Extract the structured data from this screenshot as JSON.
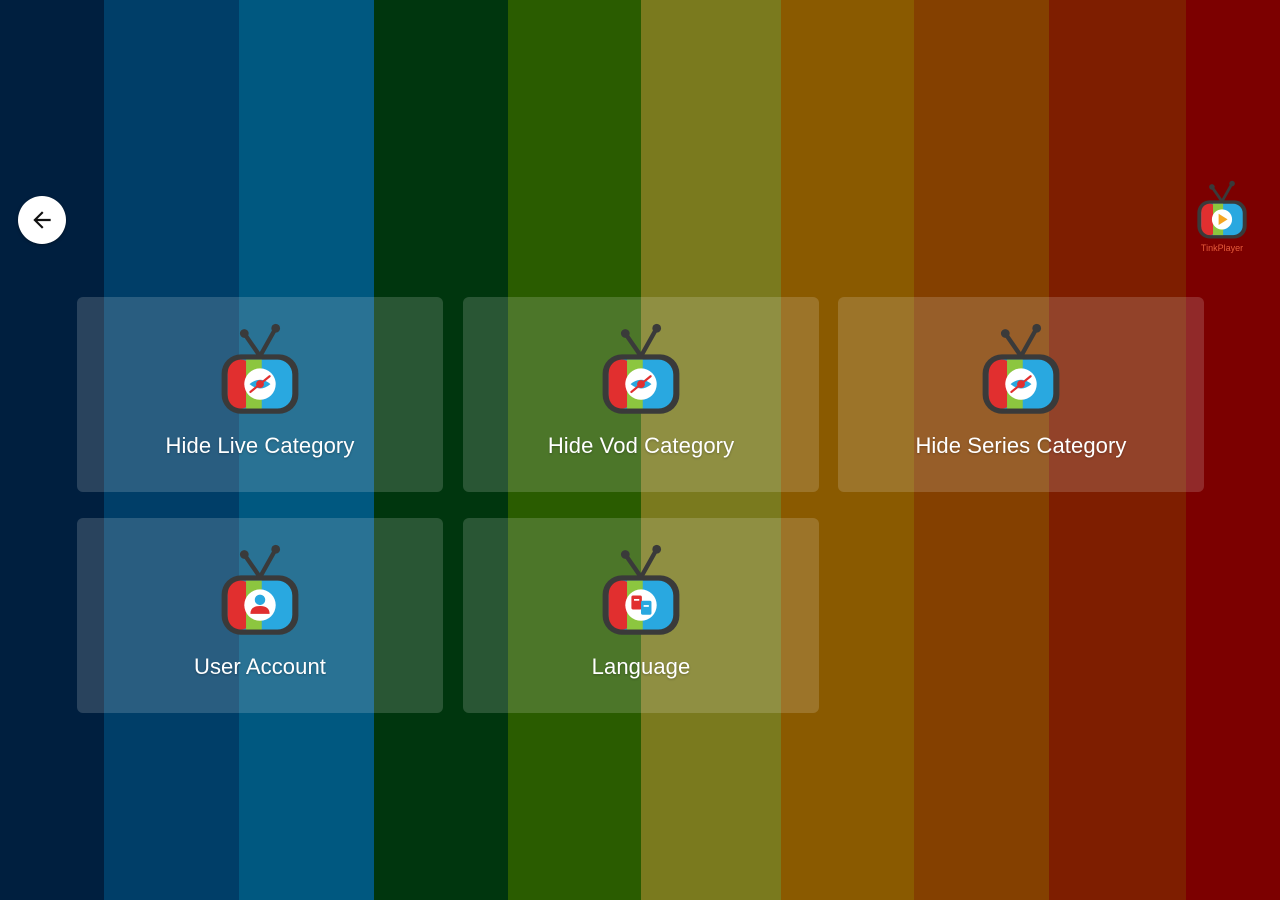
{
  "background": {
    "stripe_colors": [
      "#001f3f",
      "#003e68",
      "#005880",
      "#00360e",
      "#2a5c00",
      "#7a7a1e",
      "#8a5a00",
      "#844000",
      "#7e1e00",
      "#7c0000"
    ]
  },
  "header": {
    "back_icon": "arrow-left-icon",
    "brand_name": "TinkPlayer"
  },
  "menu": {
    "tiles": [
      {
        "label": "Hide Live Category",
        "icon": "tv-eye-icon"
      },
      {
        "label": "Hide Vod Category",
        "icon": "tv-eye-icon"
      },
      {
        "label": "Hide Series Category",
        "icon": "tv-eye-icon"
      },
      {
        "label": "User Account",
        "icon": "tv-user-icon"
      },
      {
        "label": "Language",
        "icon": "tv-language-icon"
      }
    ]
  },
  "colors": {
    "tv_red": "#e12f2f",
    "tv_green": "#8cc63f",
    "tv_blue": "#29a8e0",
    "tv_frame": "#3a3a3a"
  }
}
